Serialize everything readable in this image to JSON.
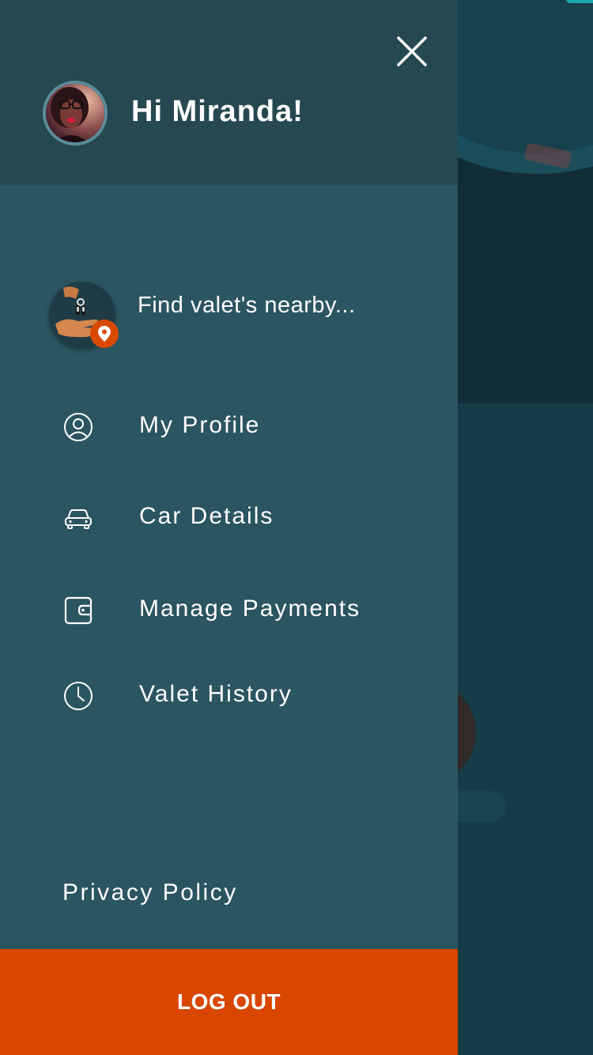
{
  "header": {
    "greeting": "Hi Miranda!"
  },
  "find_valet": {
    "label": "Find valet's nearby..."
  },
  "menu": {
    "items": [
      {
        "label": "My Profile",
        "icon": "user-circle-icon"
      },
      {
        "label": "Car Details",
        "icon": "car-icon"
      },
      {
        "label": "Manage Payments",
        "icon": "wallet-icon"
      },
      {
        "label": "Valet History",
        "icon": "clock-icon"
      }
    ]
  },
  "footer": {
    "privacy_label": "Privacy Policy",
    "logout_label": "LOG OUT"
  },
  "colors": {
    "drawer_bg": "#2b5560",
    "header_bg": "#264851",
    "accent": "#d84600",
    "backdrop": "#163c47"
  }
}
